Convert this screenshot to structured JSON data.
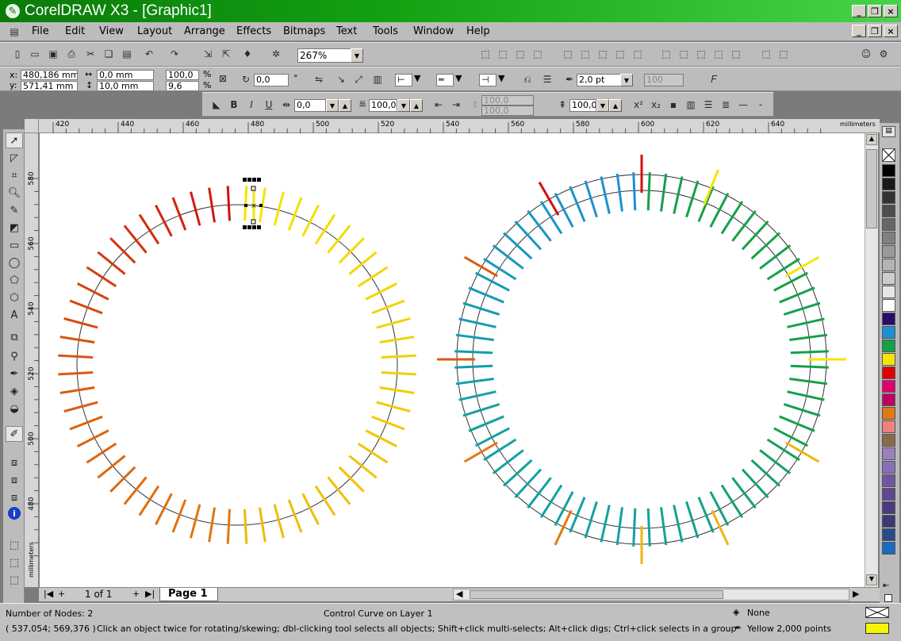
{
  "window": {
    "title": "CorelDRAW X3 - [Graphic1]"
  },
  "menu": [
    "File",
    "Edit",
    "View",
    "Layout",
    "Arrange",
    "Effects",
    "Bitmaps",
    "Text",
    "Tools",
    "Window",
    "Help"
  ],
  "toolbar": {
    "zoom": "267%"
  },
  "property_bar": {
    "x_label": "x:",
    "x_value": "480,186 mm",
    "y_label": "y:",
    "y_value": "571,41 mm",
    "width_value": "0,0 mm",
    "height_value": "10,0 mm",
    "scale_x": "100,0",
    "scale_y": "9,6",
    "percent": "%",
    "rotation": "0,0",
    "degree": "°",
    "outline_width": "2,0 pt",
    "disabled_value": "100"
  },
  "text_bar": {
    "field1": "0,0",
    "field2": "100,0",
    "field3a": "100,0",
    "field3b": "100,0",
    "field4": "100,0"
  },
  "ruler": {
    "h_ticks": [
      "420",
      "440",
      "460",
      "480",
      "500",
      "520",
      "540",
      "560",
      "580",
      "600",
      "620",
      "640"
    ],
    "h_unit": "millimeters",
    "v_ticks": [
      "580",
      "560",
      "540",
      "520",
      "500",
      "480"
    ],
    "v_unit": "millimeters"
  },
  "page_nav": {
    "counter": "1 of 1",
    "tab": "Page 1"
  },
  "status": {
    "nodes": "Number of Nodes: 2",
    "object": "Control Curve on Layer 1",
    "fill_label": "None",
    "outline_label": "Yellow  2,000 points",
    "coords": "( 537,054; 569,376 )",
    "hint": "Click an object twice for rotating/skewing; dbl-clicking tool selects all objects; Shift+click multi-selects; Alt+click digs; Ctrl+click selects in a group"
  },
  "colors": {
    "red": "#d01010",
    "yellow": "#f5e600",
    "orange": "#e07a10",
    "gold": "#ebb80a",
    "blue": "#1e8fd6",
    "teal": "#12a2a0",
    "green": "#16a04a",
    "circle": "#333333"
  },
  "palette": [
    "#000000",
    "#1a1a1a",
    "#333333",
    "#4d4d4d",
    "#666666",
    "#808080",
    "#999999",
    "#b3b3b3",
    "#cccccc",
    "#e6e6e6",
    "#ffffff",
    "#2a0a6e",
    "#1e8fd6",
    "#16a04a",
    "#f5e600",
    "#e00000",
    "#e0006e",
    "#c00060",
    "#e07a10",
    "#f08080",
    "#8a6a4a",
    "#9a80c0",
    "#8870b8",
    "#7055a0",
    "#604890",
    "#4a3a80",
    "#3a3a78",
    "#2a4a8a",
    "#1a6ac0"
  ]
}
